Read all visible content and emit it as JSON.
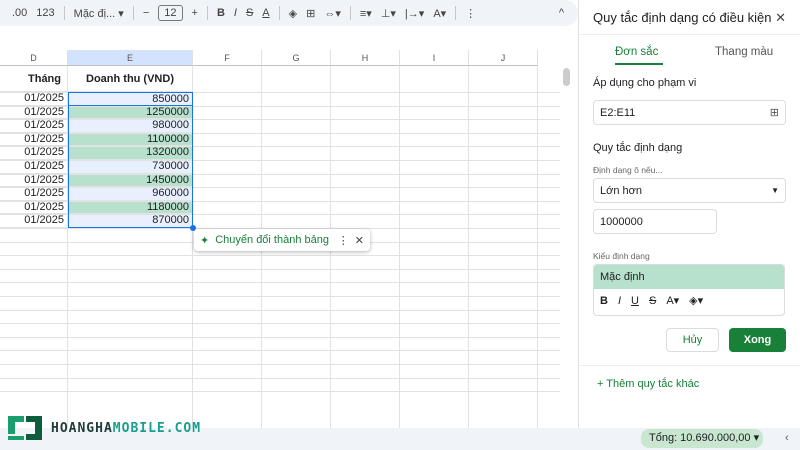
{
  "toolbar": {
    "decimal": ".00",
    "format_123": "123",
    "font": "Mặc đị...",
    "font_size": "12",
    "minus": "−",
    "plus": "+",
    "bold": "B",
    "italic": "I",
    "strike": "S",
    "text_color": "A",
    "more": "⋮",
    "collapse": "^"
  },
  "columns": [
    "D",
    "E",
    "F",
    "G",
    "H",
    "I",
    "J"
  ],
  "header_row": {
    "d": "Tháng",
    "e": "Doanh thu (VND)"
  },
  "rows": [
    {
      "month": "01/2025",
      "revenue": "850000",
      "highlight": false
    },
    {
      "month": "01/2025",
      "revenue": "1250000",
      "highlight": true
    },
    {
      "month": "01/2025",
      "revenue": "980000",
      "highlight": false
    },
    {
      "month": "01/2025",
      "revenue": "1100000",
      "highlight": true
    },
    {
      "month": "01/2025",
      "revenue": "1320000",
      "highlight": true
    },
    {
      "month": "01/2025",
      "revenue": "730000",
      "highlight": false
    },
    {
      "month": "01/2025",
      "revenue": "1450000",
      "highlight": true
    },
    {
      "month": "01/2025",
      "revenue": "960000",
      "highlight": false
    },
    {
      "month": "01/2025",
      "revenue": "1180000",
      "highlight": true
    },
    {
      "month": "01/2025",
      "revenue": "870000",
      "highlight": false
    }
  ],
  "popup": {
    "label": "Chuyển đổi thành bảng"
  },
  "panel": {
    "title": "Quy tắc định dạng có điều kiện",
    "tabs": [
      "Đơn sắc",
      "Thang màu"
    ],
    "range_label": "Áp dụng cho phạm vi",
    "range_value": "E2:E11",
    "rules_label": "Quy tắc định dạng",
    "condition_label": "Định dạng ô nếu...",
    "condition_value": "Lớn hơn",
    "value": "1000000",
    "style_label": "Kiểu định dạng",
    "style_preview": "Mặc định",
    "cancel": "Hủy",
    "done": "Xong",
    "add_rule": "+ Thêm quy tắc khác"
  },
  "status": {
    "sum": "Tổng: 10.690.000,00"
  },
  "logo": {
    "text_a": "HOANGHA",
    "text_b": "MOBILE.COM"
  },
  "colors": {
    "accent": "#188038",
    "highlight": "#b7e1cd",
    "selection": "#e8f0fe"
  }
}
